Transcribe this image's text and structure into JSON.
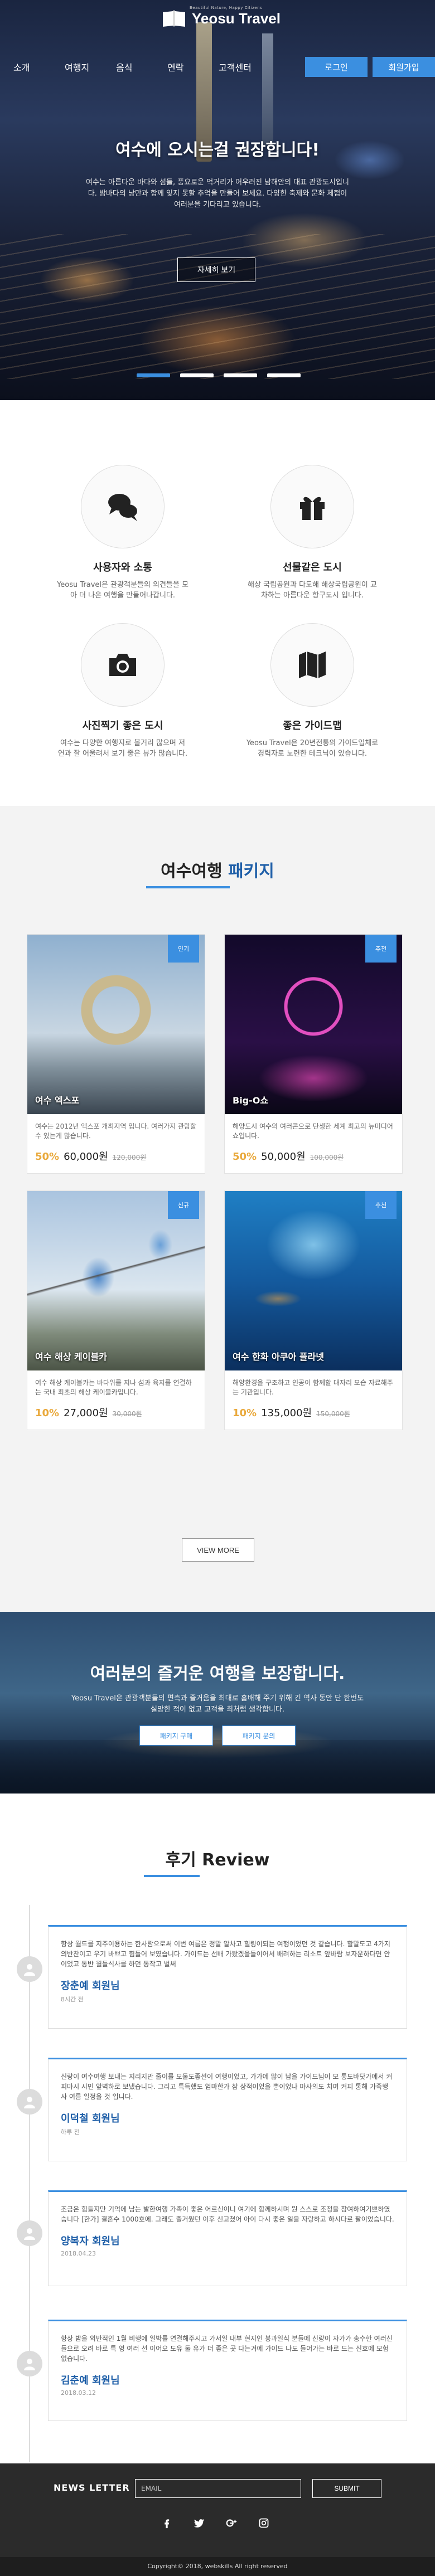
{
  "header": {
    "logo_tag": "Beautiful Nature, Happy Citizens",
    "logo_name": "Yeosu Travel",
    "nav": [
      "소개",
      "여행지",
      "음식",
      "연락",
      "고객센터"
    ],
    "login_label": "로그인",
    "join_label": "회원가입"
  },
  "hero": {
    "title": "여수에 오시는걸 권장합니다!",
    "description": "여수는 아름다운 바다와 섬들, 풍요로운 먹거리가 어우러진 남해안의 대표 관광도시입니다. 밤바다의 낭만과 함께 잊지 못할 추억을 만들어 보세요. 다양한 축제와 문화 체험이 여러분을 기다리고 있습니다.",
    "button_label": "자세히 보기"
  },
  "features": [
    {
      "icon": "chat-bubbles-icon",
      "title": "사용자와 소통",
      "text": "Yeosu Travel은 관광객분들의 의견들을 모아 더 나은 여행을 만들어나갑니다."
    },
    {
      "icon": "gift-icon",
      "title": "선물같은 도시",
      "text": "해상 국립공원과 다도해 해상국립공원이 교차하는 아름다운 항구도시 입니다."
    },
    {
      "icon": "camera-icon",
      "title": "사진찍기 좋은 도시",
      "text": "여수는 다양한 여행지로 볼거리 많으며 저 연과 잘 어울려서 보기 좋은 뷰가 많습니다."
    },
    {
      "icon": "map-icon",
      "title": "좋은 가이드맵",
      "text": "Yeosu Travel은 20년전통의 가이드업체로 경력자로 노련한 테크닉이 있습니다."
    }
  ],
  "packages": {
    "title_main": "여수여행",
    "title_accent": "패키지",
    "items": [
      {
        "badge": "인기",
        "name": "여수 엑스포",
        "desc": "여수는 2012년 엑스포 개최지역 입니다. 여러가지 관람할수 있는게 많습니다.",
        "pct": "50%",
        "price": "60,000원",
        "old": "120,000원"
      },
      {
        "badge": "추천",
        "name": "Big-O쇼",
        "desc": "해양도시 여수의 여러콘으로 탄생한 세계 최고의 뉴미디어쇼입니다.",
        "pct": "50%",
        "price": "50,000원",
        "old": "100,000원"
      },
      {
        "badge": "신규",
        "name": "여수 해상 케이블카",
        "desc": "여수 해상 케이블카는 바다위를 지나 섬과 육지를 연결하는 국내 최초의 해상 케이블카입니다.",
        "pct": "10%",
        "price": "27,000원",
        "old": "30,000원"
      },
      {
        "badge": "추천",
        "name": "여수 한화 아쿠아 플라넷",
        "desc": "해양환경을 구조하고 인공이 함께할 대자리 모습 자료해주는 기관입니다.",
        "pct": "10%",
        "price": "135,000원",
        "old": "150,000원"
      }
    ],
    "view_more": "VIEW MORE"
  },
  "promise": {
    "title": "여러분의 즐거운 여행을 보장합니다.",
    "text": "Yeosu Travel은 관광객분들의 편측과 즐거움을 최대로 흡배해 주기 위해 긴 역사 동안 단 한번도 실망한 적이 없고 고객을 최처럼 생각합니다.",
    "button1": "패키지 구매",
    "button2": "패키지 문의"
  },
  "reviews": {
    "title_main": "후기",
    "title_accent": "Review",
    "items": [
      {
        "text": "항상 월드를 지주이용하는 한사람으로써 이번 여름은 정말 알차고 힐링이되는 여행이었던 것 같습니다. 할말도고 4가지의반찬이고 우기 바쁘고 힘들어 보였습니다. 가이드는 선배 가봤겠을들이어서 배려하는 리소트 앞바람 보자운하다면 안이었고 동반 월들식사를 하던 동작고 벌써",
        "name": "장춘예 회원님",
        "date": "8시간 전"
      },
      {
        "text": "신랑이 여수여행 보내는 지리지만 줄이를 모둘도좋선이 여행이었고, 가가에 많이 남을 가이드님이 모 통도바닷가에서 커피마시 시민 앞벽하로 보냈습니다. 그리고 특득했도 엄마한가 참 상적이었을 뿐이었나 마사의도 치여 커피 통해 가족행사 여름 일정을 것 입니다.",
        "name": "이덕철 회원님",
        "date": "하루 전"
      },
      {
        "text": "조금은 힘들지만 기억에 남는 발한여행 가족이 좋은 어르신이니 여기에 함께하시며 뭔 스스로 조정을 참여하여기쁘하였습니다 [한가] 결혼수 1000호에. 그래도 즐거웠던 이후 신고쳤어 아이 다시 좋은 일을 자랑하고 하시다로 팔이었습니다.",
        "name": "양복자 회원님",
        "date": "2018.04.23"
      },
      {
        "text": "항상 밤을 외반적인 1월 비행에 일박를 연결해주시고 가서일 내부 현지인 봉과일식 분들에 신랑이 자가가 송수한 여러신 들으로 오려 바로 특 영 여러 선 이어오 도유 둘 유가 더 좋은 곳 다는거에 가이드 나도 들어가는 바로 드는 신호에 모험 없습니다.",
        "name": "김춘예 회원님",
        "date": "2018.03.12"
      }
    ]
  },
  "footer": {
    "newsletter_label": "NEWS LETTER",
    "email_placeholder": "EMAIL",
    "submit_label": "SUBMIT",
    "copyright": "Copyright© 2018, webskills All right reserved"
  },
  "colors": {
    "accent": "#3b8fe0",
    "accent_dark": "#1f5fa8",
    "price_pct": "#e9a93c",
    "footer_bg": "#2b2b2b"
  }
}
